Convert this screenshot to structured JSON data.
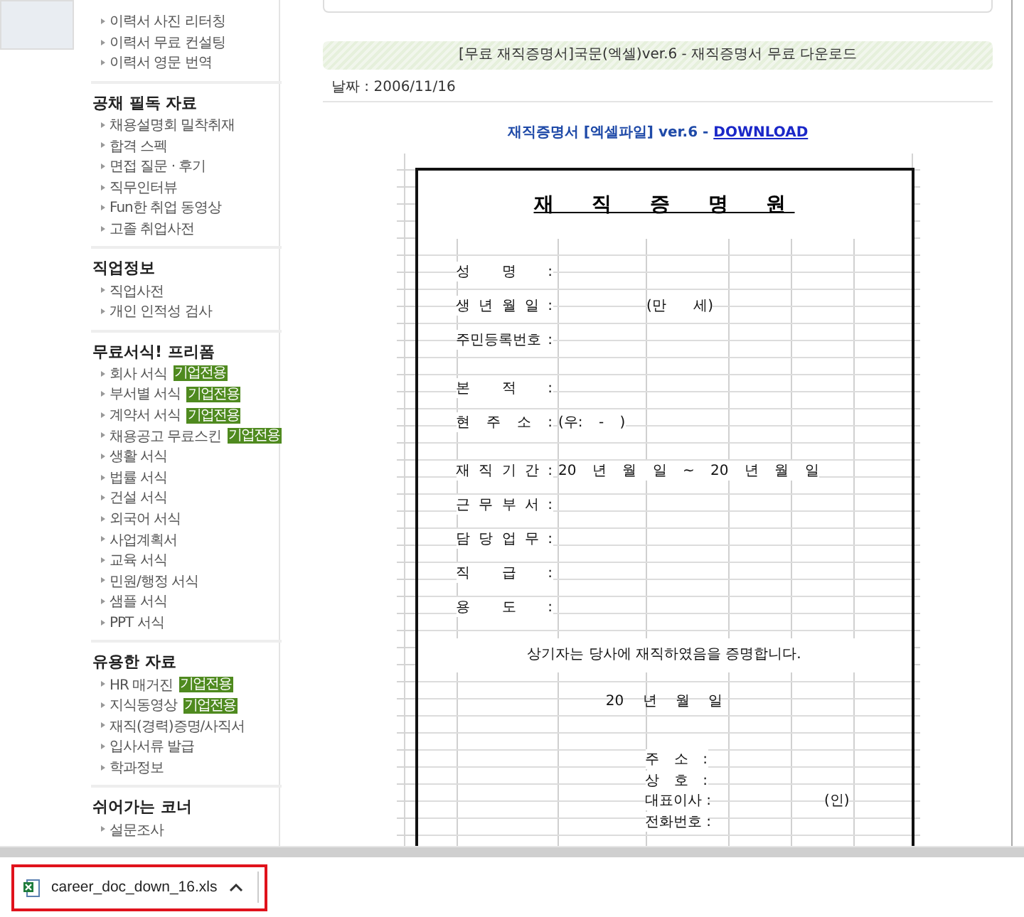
{
  "sidebar": {
    "sections": [
      {
        "items": [
          {
            "label": "이력서 사진 리터칭"
          },
          {
            "label": "이력서 무료 컨설팅"
          },
          {
            "label": "이력서 영문 번역"
          }
        ]
      },
      {
        "title": "공채 필독 자료",
        "items": [
          {
            "label": "채용설명회 밀착취재"
          },
          {
            "label": "합격 스펙"
          },
          {
            "label": "면접 질문 · 후기"
          },
          {
            "label": "직무인터뷰"
          },
          {
            "label": "Fun한 취업 동영상"
          },
          {
            "label": "고졸 취업사전"
          }
        ]
      },
      {
        "title": "직업정보",
        "items": [
          {
            "label": "직업사전"
          },
          {
            "label": "개인 인적성 검사"
          }
        ]
      },
      {
        "title": "무료서식! 프리폼",
        "items": [
          {
            "label": "회사 서식",
            "badge": "기업전용"
          },
          {
            "label": "부서별 서식",
            "badge": "기업전용"
          },
          {
            "label": "계약서 서식",
            "badge": "기업전용"
          },
          {
            "label": "채용공고 무료스킨",
            "badge": "기업전용"
          },
          {
            "label": "생활 서식"
          },
          {
            "label": "법률 서식"
          },
          {
            "label": "건설 서식"
          },
          {
            "label": "외국어 서식"
          },
          {
            "label": "사업계획서"
          },
          {
            "label": "교육 서식"
          },
          {
            "label": "민원/행정 서식"
          },
          {
            "label": "샘플 서식"
          },
          {
            "label": "PPT 서식"
          }
        ]
      },
      {
        "title": "유용한 자료",
        "items": [
          {
            "label": "HR 매거진",
            "badge": "기업전용"
          },
          {
            "label": "지식동영상",
            "badge": "기업전용"
          },
          {
            "label": "재직(경력)증명/사직서"
          },
          {
            "label": "입사서류 발급"
          },
          {
            "label": "학과정보"
          }
        ]
      },
      {
        "title": "쉬어가는 코너",
        "items": [
          {
            "label": "설문조사"
          }
        ]
      }
    ]
  },
  "post": {
    "title": "[무료 재직증명서]국문(엑셀)ver.6 - 재직증명서 무료 다운로드",
    "date": "날짜 : 2006/11/16",
    "download_text": "재직증명서 [엑셀파일] ver.6 - ",
    "download_link": "DOWNLOAD"
  },
  "document": {
    "title": "재 직 증 명 원",
    "fields": [
      {
        "label": "성 명 :"
      },
      {
        "label": "생 년 월 일 :",
        "value": "(만 세)"
      },
      {
        "label": "주민등록번호 :"
      },
      {
        "label": "본 적 :"
      },
      {
        "label": "현 주 소 :",
        "value": "(우: - )"
      },
      {
        "label": "재 직 기 간 :",
        "value": "20 년 월 일 ~ 20 년 월 일"
      },
      {
        "label": "근 무 부 서 :"
      },
      {
        "label": "담 당 업 무 :"
      },
      {
        "label": "직 급 :"
      },
      {
        "label": "용 도 :"
      }
    ],
    "statement": "상기자는 당사에 재직하였음을 증명합니다.",
    "date": "20 년 월 일",
    "issuer": [
      {
        "label": "주 소 :"
      },
      {
        "label": "상 호 :"
      },
      {
        "label": "대표이사 :",
        "note": "(인)"
      },
      {
        "label": "전화번호 :"
      }
    ]
  },
  "download_bar": {
    "file": "career_doc_down_16.xls",
    "highlighted": true
  }
}
